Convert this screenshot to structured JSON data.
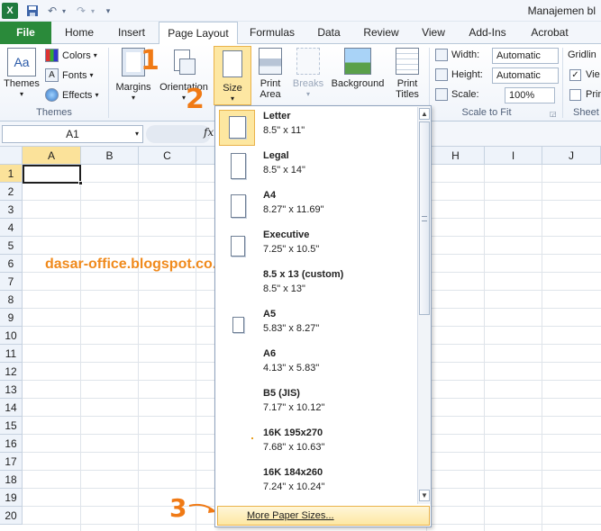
{
  "title_bar": {
    "doc_title": "Manajemen bl"
  },
  "tabs": {
    "file": "File",
    "items": [
      "Home",
      "Insert",
      "Page Layout",
      "Formulas",
      "Data",
      "Review",
      "View",
      "Add-Ins",
      "Acrobat"
    ]
  },
  "ribbon": {
    "themes_group": {
      "themes": "Themes",
      "colors": "Colors",
      "fonts": "Fonts",
      "effects": "Effects",
      "label": "Themes"
    },
    "page_setup": {
      "margins": "Margins",
      "orientation": "Orientation",
      "size": "Size",
      "print": "Print",
      "area": "Area",
      "breaks": "Breaks",
      "background": "Background",
      "print_titles_1": "Print",
      "print_titles_2": "Titles"
    },
    "scale_to_fit": {
      "width_label": "Width:",
      "width_value": "Automatic",
      "height_label": "Height:",
      "height_value": "Automatic",
      "scale_label": "Scale:",
      "scale_value": "100%",
      "label": "Scale to Fit"
    },
    "sheet_options": {
      "gridlines": "Gridlin",
      "view": "Vie",
      "print": "Prin",
      "label": "Sheet"
    }
  },
  "formula_bar": {
    "name_box": "A1",
    "fx": "fx"
  },
  "grid": {
    "columns": [
      "A",
      "B",
      "C",
      "H",
      "I",
      "J"
    ],
    "rows": [
      "1",
      "2",
      "3",
      "4",
      "5",
      "6",
      "7",
      "8",
      "9",
      "10",
      "11",
      "12",
      "13",
      "14",
      "15",
      "16",
      "17",
      "18",
      "19",
      "20"
    ]
  },
  "watermark": "dasar-office.blogspot.co.id",
  "annotations": [
    "1",
    "2",
    "3"
  ],
  "paper_sizes": [
    {
      "name": "Letter",
      "dims": "8.5\" x 11\""
    },
    {
      "name": "Legal",
      "dims": "8.5\" x 14\""
    },
    {
      "name": "A4",
      "dims": "8.27\" x 11.69\""
    },
    {
      "name": "Executive",
      "dims": "7.25\" x 10.5\""
    },
    {
      "name": "8.5 x 13 (custom)",
      "dims": "8.5\" x 13\""
    },
    {
      "name": "A5",
      "dims": "5.83\" x 8.27\""
    },
    {
      "name": "A6",
      "dims": "4.13\" x 5.83\""
    },
    {
      "name": "B5 (JIS)",
      "dims": "7.17\" x 10.12\""
    },
    {
      "name": "16K 195x270",
      "dims": "7.68\" x 10.63\""
    },
    {
      "name": "16K 184x260",
      "dims": "7.24\" x 10.24\""
    }
  ],
  "more_paper_sizes": "More Paper Sizes..."
}
